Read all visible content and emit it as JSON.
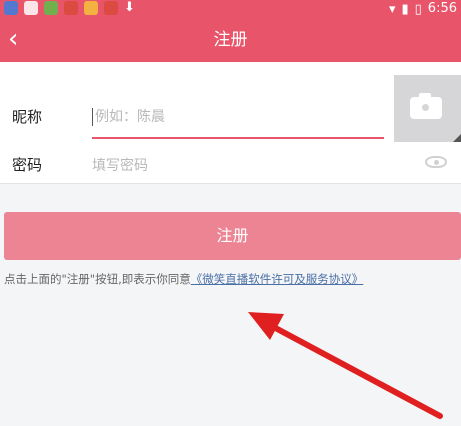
{
  "status_bar": {
    "time": "6:56",
    "icons": [
      "app-icon",
      "app-icon",
      "app-icon",
      "app-icon",
      "app-icon",
      "app-icon",
      "download-icon",
      "wifi-icon",
      "signal-icon",
      "battery-icon"
    ]
  },
  "header": {
    "back_glyph": "‹",
    "title": "注册"
  },
  "form": {
    "nickname_label": "昵称",
    "nickname_placeholder": "例如：陈晨",
    "password_label": "密码",
    "password_placeholder": "填写密码"
  },
  "actions": {
    "register_label": "注册"
  },
  "agreement": {
    "prefix": "点击上面的\"注册\"按钮,即表示你同意",
    "link_text": "《微笑直播软件许可及服务协议》"
  },
  "colors": {
    "accent": "#e8556a",
    "button": "#ec8493",
    "link": "#4a6fa5",
    "annotation_arrow": "#e02020"
  }
}
